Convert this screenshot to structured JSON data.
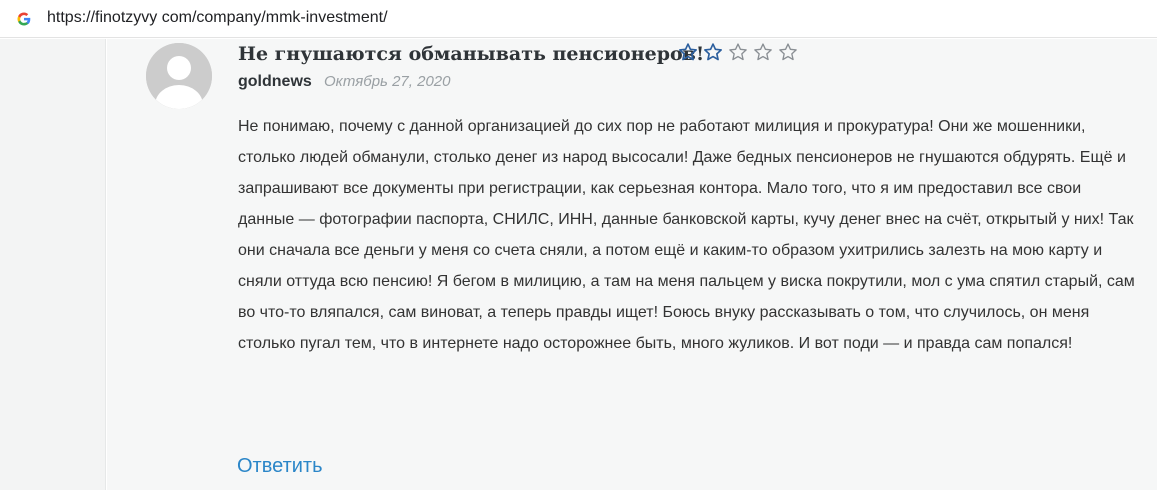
{
  "browser": {
    "url": "https://finotzyvy com/company/mmk-investment/",
    "favicon": "google-g-icon"
  },
  "comment": {
    "title": "Не гнушаются обманывать пенсионеров!",
    "rating": {
      "value": 2,
      "max": 5
    },
    "author": "goldnews",
    "date": "Октябрь 27, 2020",
    "body": "Не понимаю, почему с данной организацией до сих пор не работают милиция и прокуратура! Они же мошенники, столько людей обманули, столько денег из народ высосали! Даже бедных пенсионеров не гнушаются обдурять. Ещё и запрашивают все документы при регистрации, как серьезная контора. Мало того, что я им предоставил все свои данные — фотографии паспорта, СНИЛС, ИНН, данные банковской карты, кучу денег внес на счёт, открытый у них! Так они сначала все деньги у меня со счета сняли, а потом ещё и каким-то образом ухитрились залезть на мою карту и сняли оттуда всю пенсию! Я бегом в милицию, а там на меня пальцем у виска покрутили, мол с ума спятил старый, сам во что-то вляпался, сам виноват, а теперь правды ищет! Боюсь внуку рассказывать о том, что случилось, он меня столько пугал тем, что в интернете надо осторожнее быть, много жуликов. И вот поди — и правда сам попался!",
    "reply_label": "Ответить"
  },
  "colors": {
    "star": "#2c5f9e",
    "link": "#2b86c8",
    "background": "#f6f7f7"
  }
}
